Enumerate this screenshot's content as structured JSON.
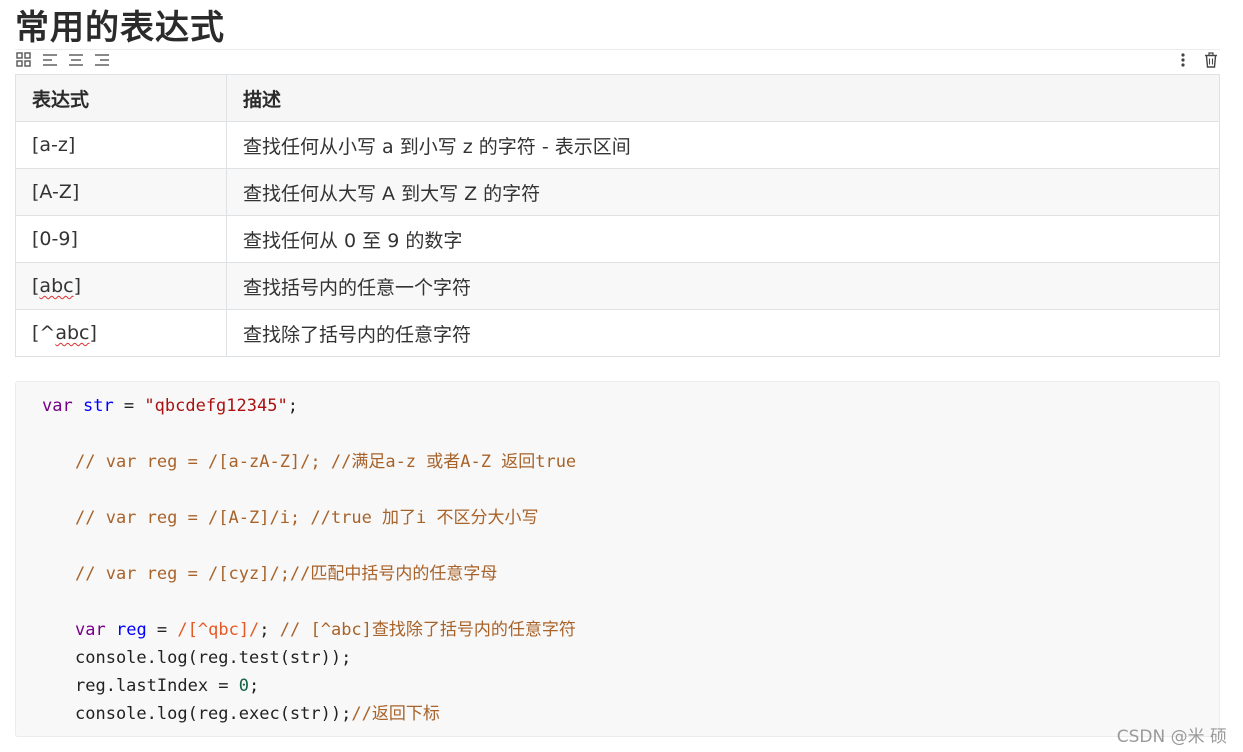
{
  "heading": "常用的表达式",
  "toolbar": {
    "left_icons": [
      "grid-icon",
      "align-left-icon",
      "align-center-icon",
      "align-right-icon"
    ],
    "right_icons": [
      "more-vertical-icon",
      "trash-icon"
    ]
  },
  "table": {
    "headers": [
      "表达式",
      "描述"
    ],
    "rows": [
      {
        "expr": "[a-z]",
        "desc": "查找任何从小写 a 到小写 z 的字符   - 表示区间"
      },
      {
        "expr": "[A-Z]",
        "desc": "查找任何从大写 A 到大写 Z 的字符"
      },
      {
        "expr": "[0-9]",
        "desc": "查找任何从 0 至 9 的数字"
      },
      {
        "expr_pre": "[",
        "expr_mark": "abc",
        "expr_post": "]",
        "desc": "查找括号内的任意一个字符"
      },
      {
        "expr_pre": "[^",
        "expr_mark": "abc",
        "expr_post": "]",
        "desc": "查找除了括号内的任意字符"
      }
    ]
  },
  "code": {
    "l1": {
      "kw": "var",
      "name": "str",
      "eq": " = ",
      "str": "\"qbcdefg12345\"",
      "end": ";"
    },
    "l2": "// var reg = /[a-zA-Z]/; //满足a-z 或者A-Z 返回true",
    "l3": "// var reg = /[A-Z]/i; //true 加了i 不区分大小写",
    "l4": "// var reg = /[cyz]/;//匹配中括号内的任意字母",
    "l5": {
      "kw": "var",
      "name": "reg",
      "eq": " = ",
      "re": "/[^qbc]/",
      "semi": "; ",
      "cm": "// [^abc]查找除了括号内的任意字符"
    },
    "l6": "console.log(reg.test(str));",
    "l7": {
      "pre": "reg.lastIndex = ",
      "num": "0",
      "end": ";"
    },
    "l8": {
      "pre": "console.log(reg.exec(str));",
      "cm": "//返回下标"
    }
  },
  "watermark": "CSDN @米 硕"
}
